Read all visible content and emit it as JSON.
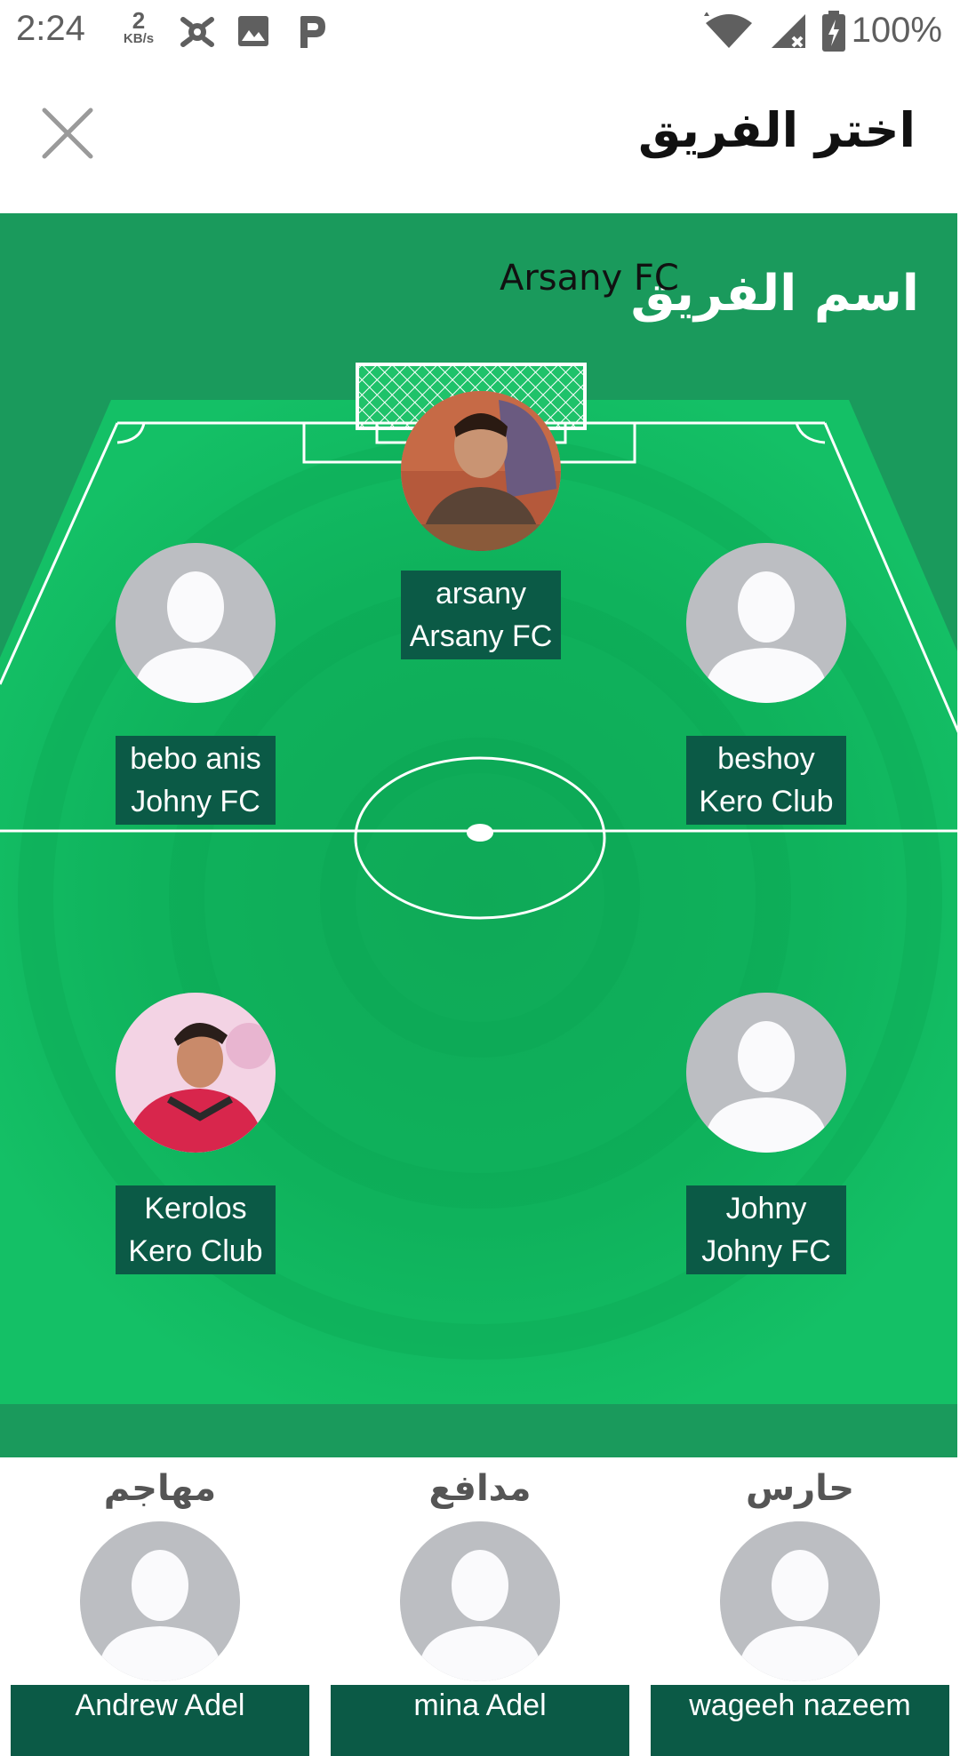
{
  "status_bar": {
    "time": "2:24",
    "net_speed_value": "2",
    "net_speed_unit": "KB/s",
    "battery": "100%",
    "icons": [
      "bug-icon",
      "image-icon",
      "p-icon",
      "wifi-icon",
      "signal-icon",
      "battery-charging-icon"
    ]
  },
  "header": {
    "title": "اختر الفريق",
    "close_icon": "close-icon"
  },
  "team": {
    "label": "اسم الفريق",
    "value": "Arsany FC"
  },
  "players": [
    {
      "name": "arsany",
      "club": "Arsany FC",
      "photo": "photo"
    },
    {
      "name": "bebo anis",
      "club": "Johny FC",
      "photo": "placeholder"
    },
    {
      "name": "beshoy",
      "club": "Kero Club",
      "photo": "placeholder"
    },
    {
      "name": "Kerolos",
      "club": "Kero Club",
      "photo": "photo"
    },
    {
      "name": "Johny",
      "club": "Johny FC",
      "photo": "placeholder"
    }
  ],
  "bench": [
    {
      "role": "مهاجم",
      "name": "Andrew Adel"
    },
    {
      "role": "مدافع",
      "name": "mina Adel"
    },
    {
      "role": "حارس",
      "name": "wageeh nazeem"
    }
  ],
  "colors": {
    "pitch": "#1a9a5c",
    "grass_light": "#0fb85f",
    "label_bg": "#0b5a46",
    "placeholder": "#bcbec2"
  }
}
